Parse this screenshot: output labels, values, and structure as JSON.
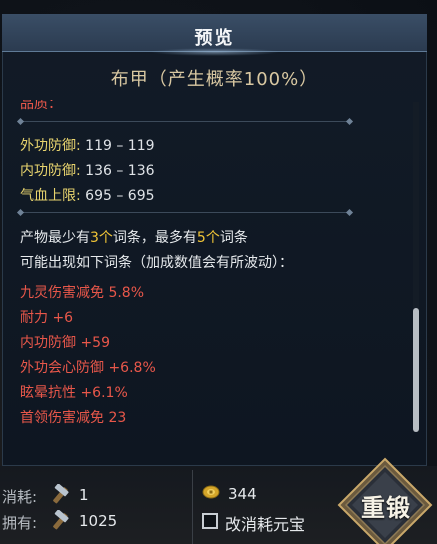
{
  "header": {
    "title": "预览"
  },
  "subtitle": "布甲（产生概率100%）",
  "partial_line": "品质：",
  "stats": [
    {
      "label": "外功防御:",
      "value": "119 – 119"
    },
    {
      "label": "内功防御:",
      "value": "136 – 136"
    },
    {
      "label": "气血上限:",
      "value": "695 – 695"
    }
  ],
  "entries_info": {
    "prefix": "产物最少有",
    "min": "3个",
    "middle": "词条，最多有",
    "max": "5个",
    "suffix": "词条",
    "line2": "可能出现如下词条（加成数值会有所波动）："
  },
  "attributes": [
    {
      "name": "九灵伤害减免",
      "value": "5.8%"
    },
    {
      "name": "耐力",
      "value": "+6"
    },
    {
      "name": "内功防御",
      "value": "+59"
    },
    {
      "name": "外功会心防御",
      "value": "+6.8%"
    },
    {
      "name": "眩晕抗性",
      "value": "+6.1%"
    },
    {
      "name": "首领伤害减免",
      "value": "23"
    }
  ],
  "bottom": {
    "consume_label": "消耗:",
    "consume_value": "1",
    "owned_label": "拥有:",
    "owned_value": "1025",
    "currency_value": "344",
    "checkbox_label": "改消耗元宝",
    "forge_label": "重锻"
  },
  "colors": {
    "stat_label": "#e8d46e",
    "gold_highlight": "#f0c437",
    "attribute_red": "#e8574a",
    "subtitle": "#d9c8a2"
  },
  "icons": [
    "hammer-icon",
    "coin-icon",
    "checkbox-icon",
    "forge-button-icon"
  ]
}
